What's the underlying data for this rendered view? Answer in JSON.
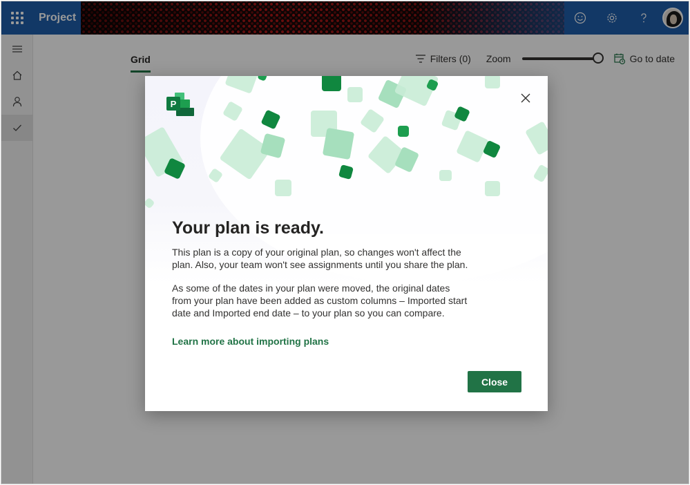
{
  "app": {
    "name": "Project"
  },
  "topbar": {
    "icons": [
      "waffle-icon",
      "feedback-smile-icon",
      "settings-gear-icon",
      "help-icon",
      "avatar"
    ]
  },
  "rail": {
    "items": [
      "menu-hamburger-icon",
      "home-icon",
      "person-icon",
      "check-icon"
    ],
    "active": "check-icon"
  },
  "toolbar": {
    "tab_label": "Grid",
    "filters_label": "Filters (0)",
    "zoom_label": "Zoom",
    "zoom_level": 1.0,
    "go_to_date_label": "Go to date"
  },
  "dialog": {
    "title": "Your plan is ready.",
    "paragraph1": "This plan is a copy of your original plan, so changes won't affect the plan. Also, your team won't see assignments until you share the plan.",
    "paragraph2": "As some of the dates in your plan were moved, the original dates from your plan have been added as custom columns – Imported start date and Imported end date – to your plan so you can compare.",
    "link_text": "Learn more about importing plans",
    "close_button": "Close"
  },
  "colors": {
    "topbar": "#1f5eaa",
    "accent_green": "#217346",
    "overlay": "rgba(0,0,0,0.4)"
  }
}
